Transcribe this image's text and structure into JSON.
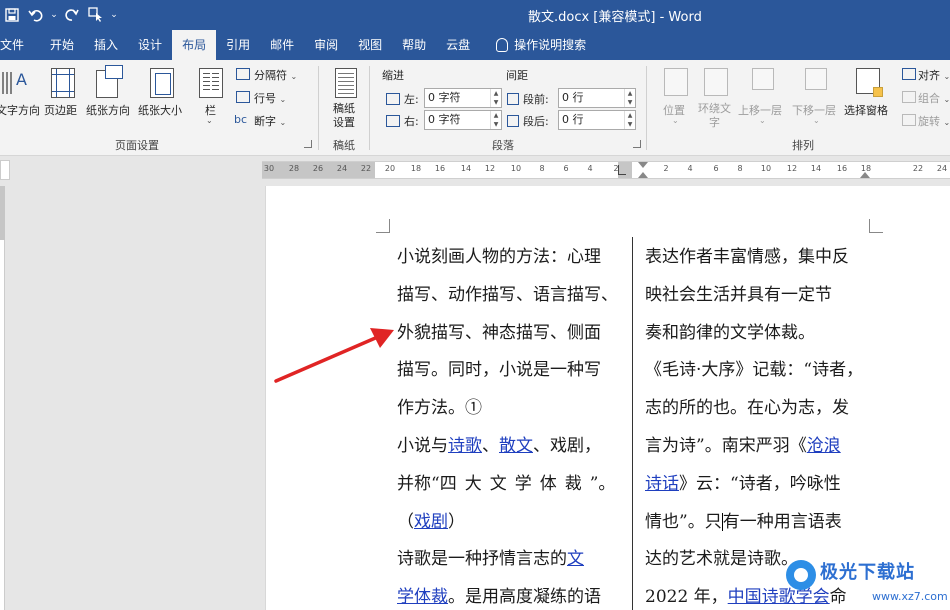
{
  "title_bar": {
    "doc_title": "散文.docx [兼容模式]  -  Word",
    "qat": {
      "save_icon": "save-icon",
      "undo_icon": "undo-icon",
      "redo_icon": "redo-icon",
      "touch_icon": "touch-mode-icon",
      "customize_glyph": "⌄"
    },
    "bg_color": "#2b579a"
  },
  "tabs": [
    "文件",
    "开始",
    "插入",
    "设计",
    "布局",
    "引用",
    "邮件",
    "审阅",
    "视图",
    "帮助",
    "云盘"
  ],
  "active_tab": "布局",
  "search_tab": "操作说明搜索",
  "ribbon": {
    "page_setup": {
      "label": "页面设置",
      "text_direction": "文字方向",
      "margins": "页边距",
      "orientation": "纸张方向",
      "size": "纸张大小",
      "columns": "栏",
      "breaks": "分隔符",
      "line_numbers": "行号",
      "hyphenation": "断字"
    },
    "draft_paper": {
      "label": "稿纸",
      "button_line1": "稿纸",
      "button_line2": "设置"
    },
    "paragraph": {
      "label": "段落",
      "indent_title": "缩进",
      "spacing_title": "间距",
      "left_label": "左:",
      "right_label": "右:",
      "before_label": "段前:",
      "after_label": "段后:",
      "left_value": "0 字符",
      "right_value": "0 字符",
      "before_value": "0 行",
      "after_value": "0 行"
    },
    "arrange": {
      "label": "排列",
      "position": "位置",
      "wrap_text_line1": "环绕文",
      "wrap_text_line2": "字",
      "bring_forward": "上移一层",
      "send_backward": "下移一层",
      "selection_pane": "选择窗格",
      "align": "对齐",
      "group": "组合",
      "rotate": "旋转"
    }
  },
  "ruler": {
    "ticks": [
      "30",
      "28",
      "26",
      "24",
      "22",
      "20",
      "18",
      "16",
      "14",
      "12",
      "10",
      "8",
      "6",
      "4",
      "2",
      "2",
      "4",
      "6",
      "8",
      "10",
      "12",
      "14",
      "16",
      "18",
      "22",
      "24"
    ]
  },
  "document": {
    "left_column": [
      {
        "parts": [
          {
            "t": "小说刻画人物的方法：心理"
          }
        ]
      },
      {
        "parts": [
          {
            "t": "描写、动作描写、语言描写、"
          }
        ]
      },
      {
        "parts": [
          {
            "t": "外貌描写、神态描写、侧面"
          }
        ]
      },
      {
        "parts": [
          {
            "t": "描写。同时，小说是一种写"
          }
        ]
      },
      {
        "parts": [
          {
            "t": "作方法。①"
          }
        ]
      },
      {
        "parts": [
          {
            "t": "小说与"
          },
          {
            "t": "诗歌",
            "link": true
          },
          {
            "t": "、"
          },
          {
            "t": "散文",
            "link": true
          },
          {
            "t": "、戏剧，"
          }
        ]
      },
      {
        "parts": [
          {
            "t": "并称“"
          },
          {
            "t": "四大文学体裁",
            "spaced": true
          },
          {
            "t": "”。"
          }
        ]
      },
      {
        "parts": [
          {
            "t": "（"
          },
          {
            "t": "戏剧",
            "link": true
          },
          {
            "t": "）"
          }
        ]
      },
      {
        "parts": [
          {
            "t": "诗歌是一种抒情言志的"
          },
          {
            "t": "文",
            "link": true
          }
        ]
      },
      {
        "parts": [
          {
            "t": "学体裁",
            "link": true
          },
          {
            "t": "。是用高度凝练的语"
          }
        ]
      }
    ],
    "right_column": [
      {
        "parts": [
          {
            "t": "表达作者丰富情感，集中反"
          }
        ]
      },
      {
        "parts": [
          {
            "t": "映社会生活并具有一定节"
          }
        ]
      },
      {
        "parts": [
          {
            "t": "奏和韵律的文学体裁。"
          }
        ]
      },
      {
        "parts": [
          {
            "t": "《毛诗·大序》记载：“诗者，"
          }
        ]
      },
      {
        "parts": [
          {
            "t": "志的所的也。在心为志，发"
          }
        ]
      },
      {
        "parts": [
          {
            "t": "言为诗”。南宋严羽《"
          },
          {
            "t": "沧浪",
            "link": true
          }
        ]
      },
      {
        "parts": [
          {
            "t": "诗话",
            "link": true
          },
          {
            "t": "》云：“诗者，吟咏性"
          }
        ]
      },
      {
        "parts": [
          {
            "t": "情也”。只"
          },
          {
            "cursor": true
          },
          {
            "t": "有一种用言语表"
          }
        ]
      },
      {
        "parts": [
          {
            "t": "达的艺术就是诗歌。"
          }
        ]
      },
      {
        "parts": [
          {
            "t": "2022 年，"
          },
          {
            "t": "中国诗歌学会",
            "link": true
          },
          {
            "t": "命"
          }
        ]
      }
    ]
  },
  "watermark": {
    "text": "极光下载站",
    "url": "www.xz7.com"
  }
}
